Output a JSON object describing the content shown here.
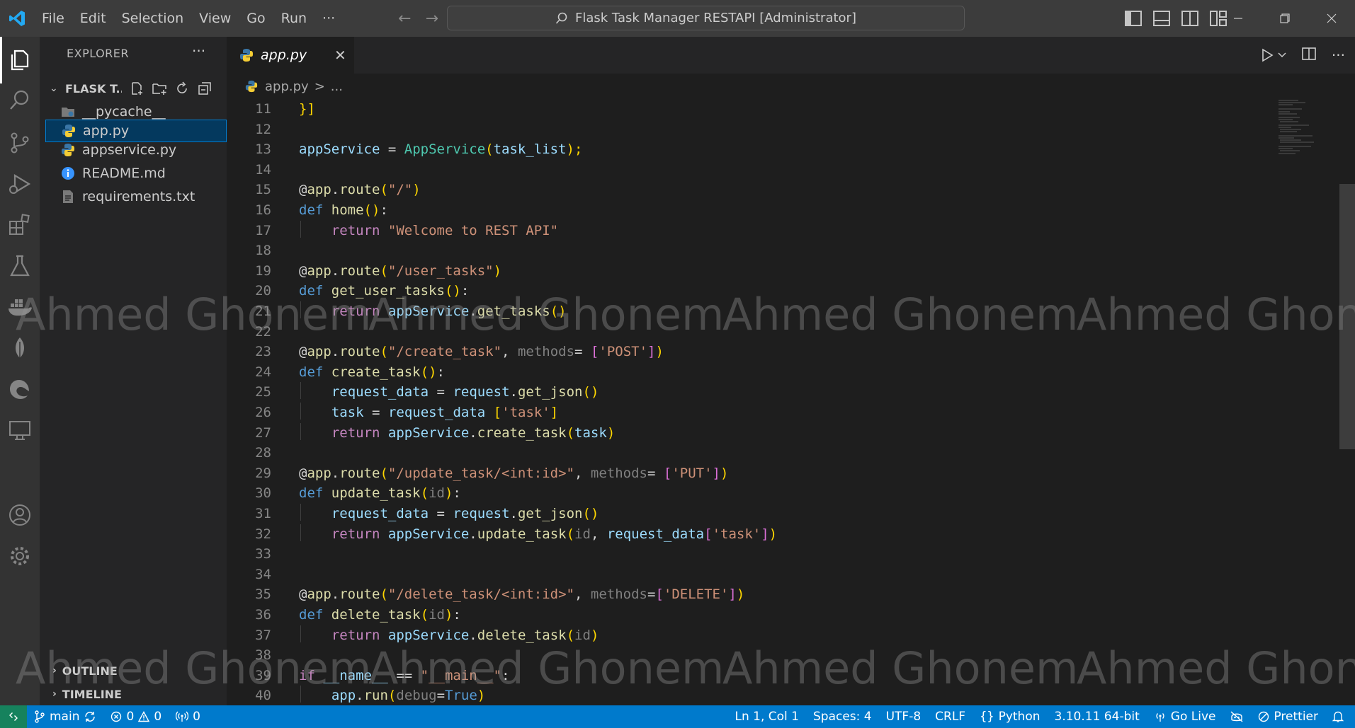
{
  "titlebar": {
    "menu": [
      "File",
      "Edit",
      "Selection",
      "View",
      "Go",
      "Run",
      "···"
    ],
    "search_text": "Flask Task Manager RESTAPI [Administrator]"
  },
  "sidebar": {
    "title": "EXPLORER",
    "more": "···",
    "folder_name": "FLASK T...",
    "files": [
      {
        "name": "__pycache__",
        "icon": "folder-icon"
      },
      {
        "name": "app.py",
        "icon": "python-icon",
        "selected": true
      },
      {
        "name": "appservice.py",
        "icon": "python-icon"
      },
      {
        "name": "README.md",
        "icon": "info-icon"
      },
      {
        "name": "requirements.txt",
        "icon": "text-file-icon"
      }
    ],
    "outline": "OUTLINE",
    "timeline": "TIMELINE"
  },
  "tabs": [
    {
      "label": "app.py",
      "close": "✕"
    }
  ],
  "breadcrumb": {
    "file": "app.py",
    "sep": ">",
    "rest": "..."
  },
  "code": [
    {
      "n": "11",
      "t": "}]"
    },
    {
      "n": "12",
      "t": ""
    },
    {
      "n": "13",
      "t": "appService = AppService(task_list);"
    },
    {
      "n": "14",
      "t": ""
    },
    {
      "n": "15",
      "t": "@app.route(\"/\")"
    },
    {
      "n": "16",
      "t": "def home():"
    },
    {
      "n": "17",
      "t": "    return \"Welcome to REST API\""
    },
    {
      "n": "18",
      "t": ""
    },
    {
      "n": "19",
      "t": "@app.route(\"/user_tasks\")"
    },
    {
      "n": "20",
      "t": "def get_user_tasks():"
    },
    {
      "n": "21",
      "t": "    return appService.get_tasks()"
    },
    {
      "n": "22",
      "t": ""
    },
    {
      "n": "23",
      "t": "@app.route(\"/create_task\", methods= ['POST'])"
    },
    {
      "n": "24",
      "t": "def create_task():"
    },
    {
      "n": "25",
      "t": "    request_data = request.get_json()"
    },
    {
      "n": "26",
      "t": "    task = request_data ['task']"
    },
    {
      "n": "27",
      "t": "    return appService.create_task(task)"
    },
    {
      "n": "28",
      "t": ""
    },
    {
      "n": "29",
      "t": "@app.route(\"/update_task/<int:id>\", methods= ['PUT'])"
    },
    {
      "n": "30",
      "t": "def update_task(id):"
    },
    {
      "n": "31",
      "t": "    request_data = request.get_json()"
    },
    {
      "n": "32",
      "t": "    return appService.update_task(id, request_data['task'])"
    },
    {
      "n": "33",
      "t": ""
    },
    {
      "n": "34",
      "t": ""
    },
    {
      "n": "35",
      "t": "@app.route(\"/delete_task/<int:id>\", methods=['DELETE'])"
    },
    {
      "n": "36",
      "t": "def delete_task(id):"
    },
    {
      "n": "37",
      "t": "    return appService.delete_task(id)"
    },
    {
      "n": "38",
      "t": ""
    },
    {
      "n": "39",
      "t": "if __name__ == \"__main__\":"
    },
    {
      "n": "40",
      "t": "    app.run(debug=True)"
    }
  ],
  "watermark": "Ahmed Ghonem",
  "statusbar": {
    "branch": "main",
    "errors": "0",
    "warnings": "0",
    "ports": "0",
    "position": "Ln 1, Col 1",
    "spaces": "Spaces: 4",
    "encoding": "UTF-8",
    "eol": "CRLF",
    "language": "Python",
    "interpreter": "3.10.11 64-bit",
    "golive": "Go Live",
    "prettier": "Prettier"
  },
  "colors": {
    "statusbar": "#007acc",
    "remote": "#16825d",
    "selection": "#04395e",
    "keyword": "#569cd6",
    "string": "#ce9178",
    "function": "#dcdcaa"
  }
}
